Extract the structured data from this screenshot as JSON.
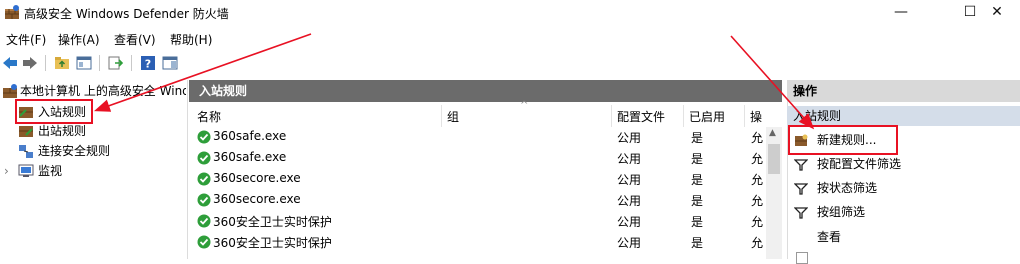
{
  "window": {
    "title": "高级安全 Windows Defender 防火墙",
    "minimize_glyph": "—",
    "maximize_glyph": "☐",
    "close_glyph": "✕"
  },
  "menu": [
    "文件(F)",
    "操作(A)",
    "查看(V)",
    "帮助(H)"
  ],
  "toolbar": {
    "icons": [
      "back-arrow-icon",
      "forward-arrow-icon",
      "folder-up-icon",
      "show-hide-tree-icon",
      "export-list-icon",
      "help-icon",
      "show-hide-action-pane-icon"
    ]
  },
  "tree": {
    "root": "本地计算机 上的高级安全 Windows Defender 防火墙",
    "items": [
      "入站规则",
      "出站规则",
      "连接安全规则",
      "监视"
    ]
  },
  "center": {
    "header": "入站规则",
    "columns": [
      "名称",
      "组",
      "配置文件",
      "已启用",
      "操"
    ],
    "rows": [
      {
        "name": "360safe.exe",
        "group": "",
        "profile": "公用",
        "enabled": "是",
        "action": "允"
      },
      {
        "name": "360safe.exe",
        "group": "",
        "profile": "公用",
        "enabled": "是",
        "action": "允"
      },
      {
        "name": "360secore.exe",
        "group": "",
        "profile": "公用",
        "enabled": "是",
        "action": "允"
      },
      {
        "name": "360secore.exe",
        "group": "",
        "profile": "公用",
        "enabled": "是",
        "action": "允"
      },
      {
        "name": "360安全卫士实时保护",
        "group": "",
        "profile": "公用",
        "enabled": "是",
        "action": "允"
      },
      {
        "name": "360安全卫士实时保护",
        "group": "",
        "profile": "公用",
        "enabled": "是",
        "action": "允"
      }
    ]
  },
  "actions": {
    "header": "操作",
    "subheader": "入站规则",
    "items": [
      "新建规则...",
      "按配置文件筛选",
      "按状态筛选",
      "按组筛选",
      "查看"
    ]
  },
  "colors": {
    "center_header_bg": "#6b6b6b",
    "action_header_bg": "#d9d9d9",
    "action_subheader_bg": "#d4dde9",
    "highlight_red": "#e81123",
    "check_green": "#2e9e3a"
  }
}
